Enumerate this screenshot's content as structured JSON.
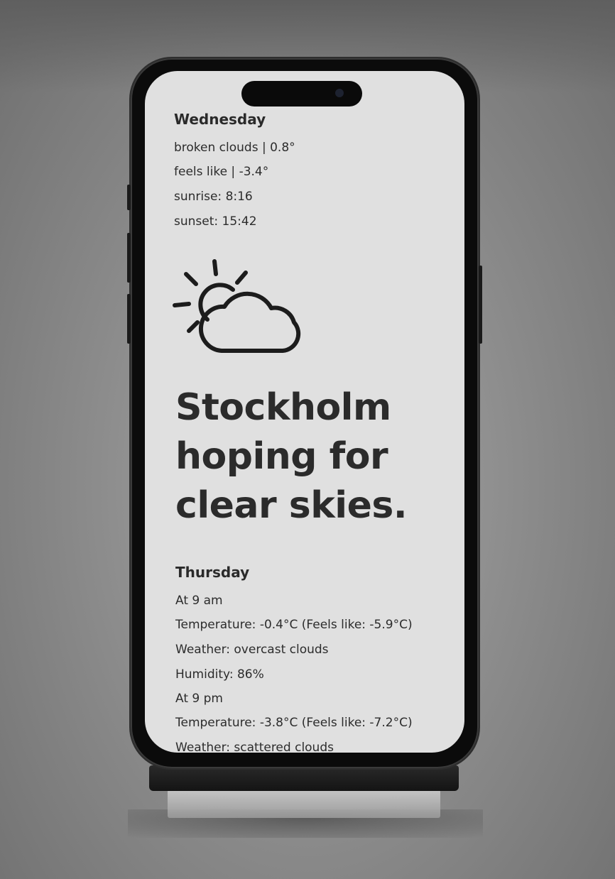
{
  "today": {
    "day": "Wednesday",
    "condition_line": "broken clouds | 0.8°",
    "feels_like_line": "feels like | -3.4°",
    "sunrise_line": "sunrise: 8:16",
    "sunset_line": "sunset: 15:42",
    "icon": "sun-behind-cloud-icon"
  },
  "headline": {
    "line1": "Stockholm",
    "line2": "hoping for",
    "line3": "clear skies."
  },
  "forecast": {
    "day": "Thursday",
    "lines": [
      "At 9 am",
      "Temperature: -0.4°C (Feels like: -5.9°C)",
      "Weather: overcast clouds",
      "Humidity: 86%",
      "At 9 pm",
      "Temperature: -3.8°C (Feels like: -7.2°C)",
      "Weather: scattered clouds"
    ]
  },
  "colors": {
    "screen_background": "#e0e0e0",
    "text": "#2b2b2b",
    "device_frame": "#0b0b0b"
  }
}
